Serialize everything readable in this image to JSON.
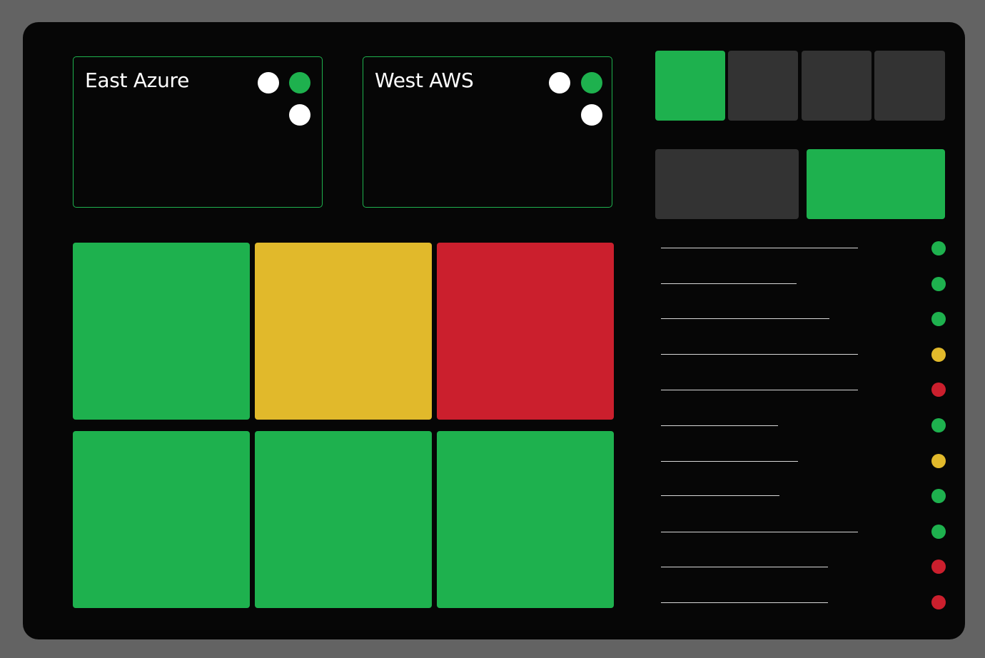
{
  "colors": {
    "green": "#1eb14e",
    "yellow": "#e1b92b",
    "red": "#cb1f2d",
    "white": "#ffffff",
    "gray": "#333333"
  },
  "regions": [
    {
      "title": "East Azure",
      "indicators": [
        "white",
        "green",
        "white"
      ]
    },
    {
      "title": "West AWS",
      "indicators": [
        "white",
        "green",
        "white"
      ]
    }
  ],
  "tiles": [
    "green",
    "yellow",
    "red",
    "green",
    "green",
    "green"
  ],
  "top_segments": [
    "green",
    "gray",
    "gray",
    "gray"
  ],
  "toggle_segments": [
    "gray",
    "green"
  ],
  "status_list": [
    {
      "status": "green"
    },
    {
      "status": "green"
    },
    {
      "status": "green"
    },
    {
      "status": "yellow"
    },
    {
      "status": "red"
    },
    {
      "status": "green"
    },
    {
      "status": "yellow"
    },
    {
      "status": "green"
    },
    {
      "status": "green"
    },
    {
      "status": "red"
    },
    {
      "status": "red"
    }
  ]
}
